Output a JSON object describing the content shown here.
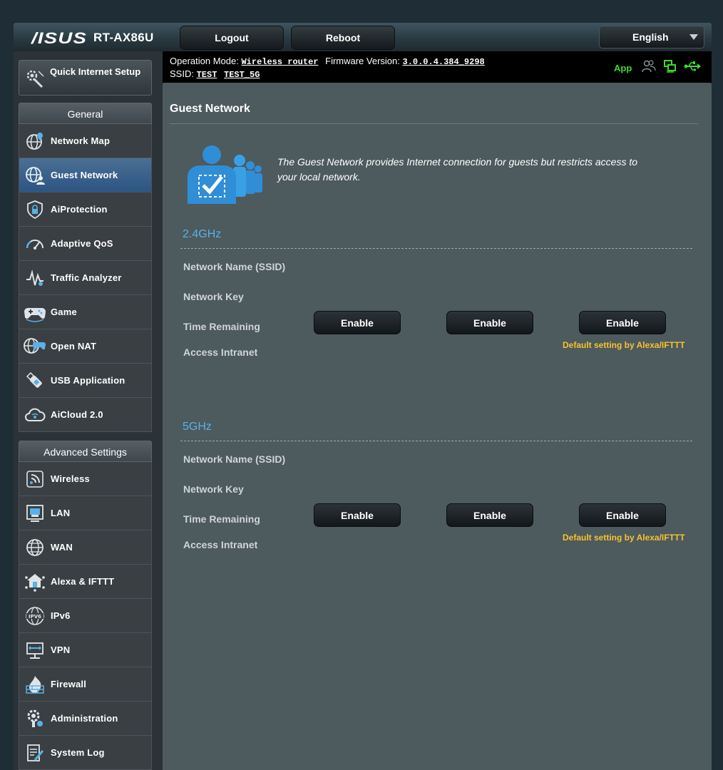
{
  "header": {
    "brand": "/ISUS",
    "model": "RT-AX86U",
    "logout_label": "Logout",
    "reboot_label": "Reboot",
    "language": "English"
  },
  "status": {
    "op_mode_label": "Operation Mode:",
    "op_mode_value": "Wireless router",
    "fw_label": "Firmware Version:",
    "fw_value": "3.0.0.4.384_9298",
    "ssid_label": "SSID:",
    "ssid_24": "TEST",
    "ssid_5": "TEST_5G",
    "app_label": "App",
    "colors": {
      "app": "#3ddc2c",
      "usb": "#3ddc2c",
      "network": "#3ddc2c"
    }
  },
  "sidebar": {
    "qis": {
      "label": "Quick Internet Setup",
      "icon": "wand-gear-icon"
    },
    "general_title": "General",
    "general_items": [
      {
        "label": "Network Map",
        "icon": "globe-pin-icon"
      },
      {
        "label": "Guest Network",
        "icon": "globe-people-icon",
        "active": true
      },
      {
        "label": "AiProtection",
        "icon": "shield-lock-icon"
      },
      {
        "label": "Adaptive QoS",
        "icon": "gauge-icon"
      },
      {
        "label": "Traffic Analyzer",
        "icon": "waveform-icon"
      },
      {
        "label": "Game",
        "icon": "gamepad-icon"
      },
      {
        "label": "Open NAT",
        "icon": "globe-gamepad-icon"
      },
      {
        "label": "USB Application",
        "icon": "usb-stick-icon"
      },
      {
        "label": "AiCloud 2.0",
        "icon": "cloud-icon"
      }
    ],
    "advanced_title": "Advanced Settings",
    "advanced_items": [
      {
        "label": "Wireless",
        "icon": "wifi-icon"
      },
      {
        "label": "LAN",
        "icon": "lan-port-icon"
      },
      {
        "label": "WAN",
        "icon": "globe-icon"
      },
      {
        "label": "Alexa & IFTTT",
        "icon": "smart-home-icon"
      },
      {
        "label": "IPv6",
        "icon": "ipv6-icon"
      },
      {
        "label": "VPN",
        "icon": "vpn-monitor-icon"
      },
      {
        "label": "Firewall",
        "icon": "firewall-icon"
      },
      {
        "label": "Administration",
        "icon": "admin-gear-icon"
      },
      {
        "label": "System Log",
        "icon": "log-pen-icon"
      }
    ]
  },
  "main": {
    "title": "Guest Network",
    "description": "The Guest Network provides Internet connection for guests but restricts access to your local network.",
    "bands": [
      {
        "name": "2.4GHz",
        "rows": [
          "Network Name (SSID)",
          "Network Key",
          "Time Remaining",
          "Access Intranet"
        ],
        "buttons": [
          "Enable",
          "Enable",
          "Enable"
        ],
        "note": "Default setting by Alexa/IFTTT"
      },
      {
        "name": "5GHz",
        "rows": [
          "Network Name (SSID)",
          "Network Key",
          "Time Remaining",
          "Access Intranet"
        ],
        "buttons": [
          "Enable",
          "Enable",
          "Enable"
        ],
        "note": "Default setting by Alexa/IFTTT"
      }
    ]
  }
}
